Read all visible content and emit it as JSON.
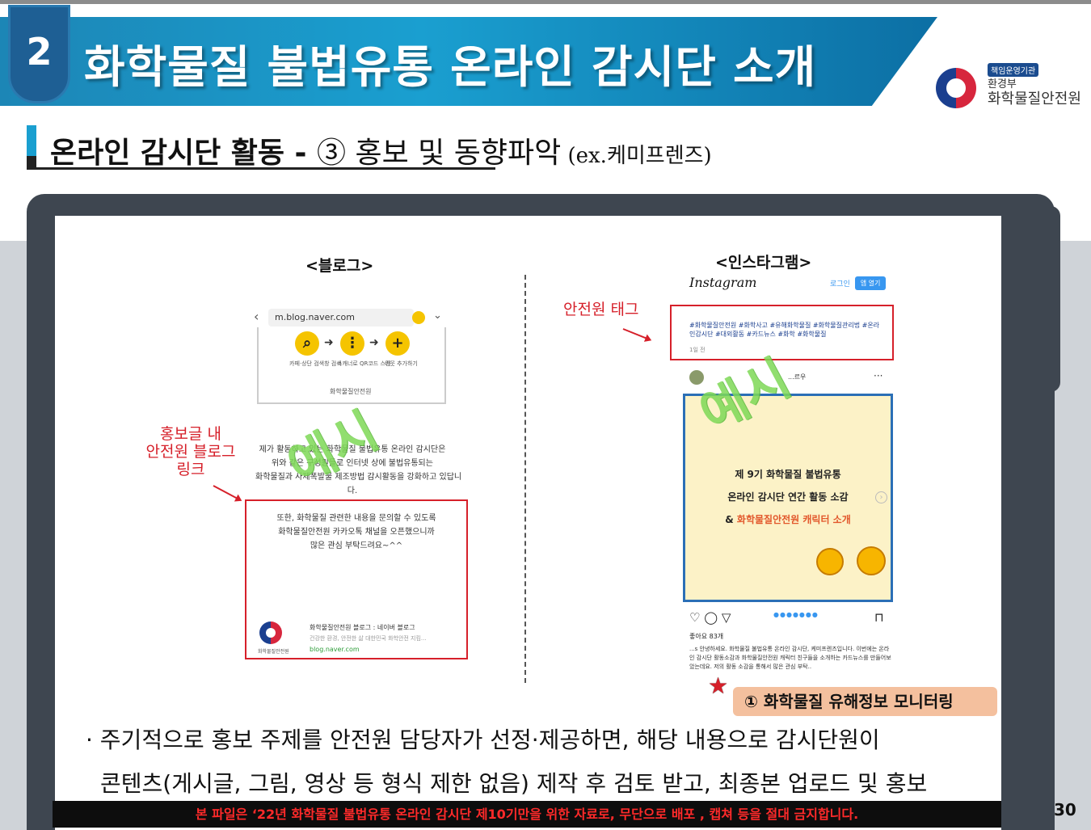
{
  "header": {
    "section_number": "2",
    "title": "화학물질 불법유통 온라인 감시단 소개",
    "logo": {
      "badge": "책임운영기관",
      "line1": "환경부",
      "line2": "화학물질안전원"
    }
  },
  "subtitle": {
    "main": "온라인 감시단 활동 - ",
    "detail": "③ 홍보 및 동향파악",
    "note": " (ex.케미프렌즈)"
  },
  "blog": {
    "label": "<블로그>",
    "url": "m.blog.naver.com",
    "icon_captions": [
      "카페·상단 검색창 검색",
      "스캐너로 QR코드 스캔",
      "이웃 추가하기"
    ],
    "card_org": "화학물질안전원",
    "intro_lines": [
      "제가 활동하고 있는 화학물질 불법유통 온라인 감시단은",
      "위와 같은 구성원들로 인터넷 상에 불법유통되는",
      "화학물질과 사제폭발물 제조방법 감시활동을 강화하고 있답니",
      "다."
    ],
    "box_lines": [
      "또한, 화학물질 관련한 내용을 문의할 수 있도록",
      "화학물질안전원 카카오톡 채널을 오픈했으니까",
      "많은 관심 부탁드려요~^^"
    ],
    "footer_title": "화학물질안전원 블로그 : 네이버 블로그",
    "footer_desc": "건강한 환경, 안전한 삶 대한민국 화학안전 지킴...",
    "footer_url": "blog.naver.com",
    "footer_seal_caption": "화학물질안전원",
    "annotation_lines": [
      "홍보글 내",
      "안전원 블로그",
      "링크"
    ]
  },
  "instagram": {
    "label": "<인스타그램>",
    "logo_text": "Instagram",
    "login": "로그인",
    "open_app": "앱 열기",
    "tags": "#화학물질안전원 #화학사고 #유해화학물질 #화학물질관리법 #온라인감시단 #대외활동 #카드뉴스 #화학 #화학물질",
    "date": "1일 전",
    "account": "...르우",
    "post_lines": [
      "제 9기 화학물질 불법유통",
      "온라인 감시단 연간 활동 소감"
    ],
    "post_line3_prefix": "& ",
    "post_line3_highlight": "화학물질안전원 캐릭터 소개",
    "likes": "좋아요 83개",
    "caption": "...s 안녕하세요. 화학물질 불법유통 온라인 감시단, 케미프렌즈입니다. 이번에는 온라인 감시단 활동소감과 화학물질안전원 캐릭터 친구들을 소개하는 카드뉴스를 만들어보았는데요. 저의 활동 소감을 통해서 많은 관심 부탁..",
    "annotation": "안전원 태그"
  },
  "watermark_text": "예시",
  "monitoring_tag": "① 화학물질 유해정보 모니터링",
  "description": {
    "line1": "· 주기적으로 홍보 주제를 안전원 담당자가 선정·제공하면, 해당 내용으로 감시단원이",
    "line2": "콘텐츠(게시글, 그림, 영상 등 형식 제한 없음) 제작 후 검토 받고, 최종본 업로드 및 홍보"
  },
  "notice": "본 파일은 ‘22년 화학물질 불법유통 온라인 감시단 제10기만을 위한 자료로, 무단으로 배포 , 캡쳐 등을 절대 금지합니다.",
  "page_number": "30",
  "colors": {
    "accent_blue": "#1a9fd0",
    "annotation_red": "#d6202a",
    "watermark_green": "#7ed957",
    "tag_orange": "#f4c09e"
  }
}
